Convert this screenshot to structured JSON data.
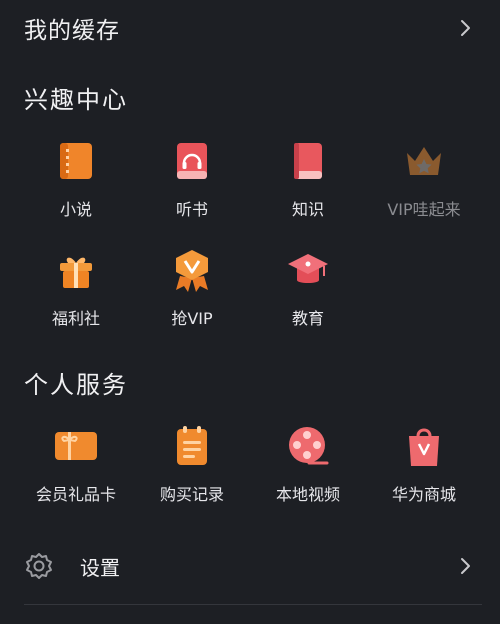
{
  "cache": {
    "title": "我的缓存",
    "chevron_icon": "chevron-right-icon"
  },
  "interest": {
    "title": "兴趣中心",
    "items": [
      {
        "label": "小说",
        "icon": "novel-book-icon",
        "dim": false
      },
      {
        "label": "听书",
        "icon": "audiobook-headphones-icon",
        "dim": false
      },
      {
        "label": "知识",
        "icon": "knowledge-book-icon",
        "dim": false
      },
      {
        "label": "VIP哇起来",
        "icon": "vip-crown-icon",
        "dim": true
      },
      {
        "label": "福利社",
        "icon": "gift-box-icon",
        "dim": false
      },
      {
        "label": "抢VIP",
        "icon": "vip-badge-icon",
        "dim": false
      },
      {
        "label": "教育",
        "icon": "graduation-cap-icon",
        "dim": false
      }
    ]
  },
  "services": {
    "title": "个人服务",
    "items": [
      {
        "label": "会员礼品卡",
        "icon": "gift-card-icon"
      },
      {
        "label": "购买记录",
        "icon": "purchase-record-icon"
      },
      {
        "label": "本地视频",
        "icon": "film-reel-icon"
      },
      {
        "label": "华为商城",
        "icon": "shopping-bag-icon"
      }
    ]
  },
  "settings": {
    "label": "设置",
    "icon": "gear-icon",
    "chevron_icon": "chevron-right-icon"
  },
  "colors": {
    "background": "#1d1f24",
    "accent_orange": "#f08a2e",
    "accent_red": "#f06a6a"
  }
}
